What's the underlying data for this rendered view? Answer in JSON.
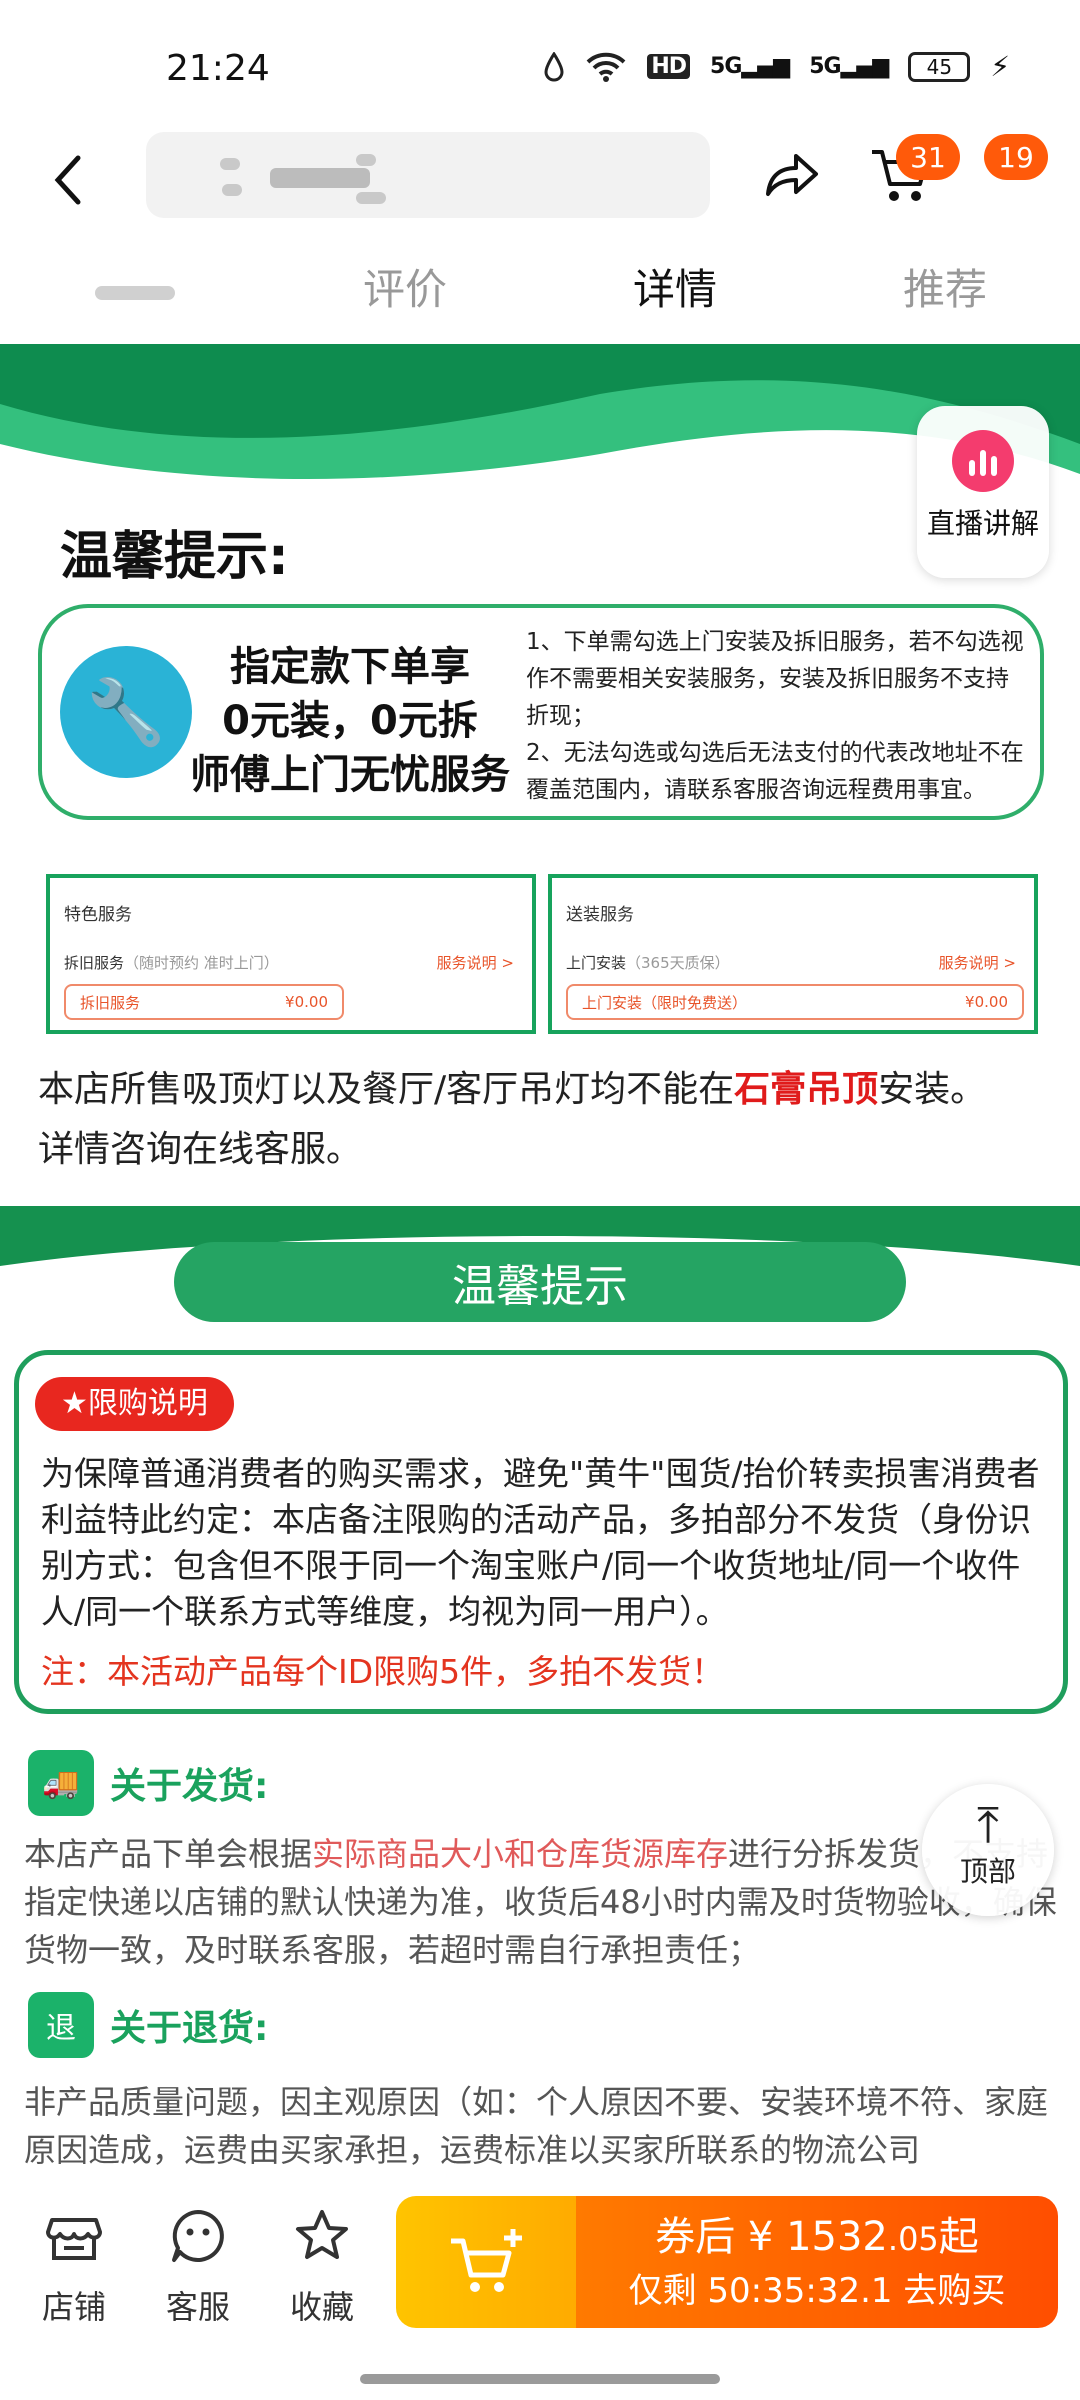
{
  "status_bar": {
    "time": "21:24",
    "network_hd": "HD",
    "signal1": "5G",
    "signal2": "5G",
    "battery": "45",
    "icons": [
      "dnd-drop-icon",
      "wifi-icon",
      "hd-icon",
      "signal-5g-icon",
      "signal-5g-icon",
      "battery-icon",
      "charging-icon"
    ]
  },
  "header": {
    "back_icon": "chevron-left-icon",
    "share_icon": "share-icon",
    "cart_icon": "cart-icon",
    "cart_badge": "31",
    "more_badge": "19"
  },
  "tabs": [
    {
      "label": "",
      "active": false
    },
    {
      "label": "评价",
      "active": false
    },
    {
      "label": "详情",
      "active": true
    },
    {
      "label": "推荐",
      "active": false
    }
  ],
  "content": {
    "live_button_label": "直播讲解",
    "warm_tip_title": "温馨提示:",
    "service_card": {
      "headline_line1": "指定款下单享",
      "headline_line2": "0元装，0元拆",
      "headline_line3": "师傅上门无忧服务",
      "note1": "1、下单需勾选上门安装及拆旧服务，若不勾选视作不需要相关安装服务，安装及拆旧服务不支持折现；",
      "note2": "2、无法勾选或勾选后无法支付的代表改地址不在覆盖范围内，请联系客服咨询远程费用事宜。"
    },
    "option_left": {
      "title": "特色服务",
      "line": "拆旧服务",
      "line_muted": "（随时预约 准时上门）",
      "link": "服务说明 >",
      "pill_label": "拆旧服务",
      "pill_price": "¥0.00"
    },
    "option_right": {
      "title": "送装服务",
      "line": "上门安装",
      "line_muted": "（365天质保）",
      "link": "服务说明 >",
      "pill_label": "上门安装（限时免费送）",
      "pill_price": "¥0.00"
    },
    "notice_pre": "本店所售吸顶灯以及餐厅/客厅吊灯均不能在",
    "notice_red": "石膏吊顶",
    "notice_post": "安装。",
    "notice_line2": "详情咨询在线客服。",
    "pill_title": "温馨提示",
    "limit_tag": "★限购说明",
    "limit_text": "为保障普通消费者的购买需求，避免\"黄牛\"囤货/抬价转卖损害消费者利益特此约定：本店备注限购的活动产品，多拍部分不发货（身份识别方式：包含但不限于同一个淘宝账户/同一个收货地址/同一个收件人/同一个联系方式等维度，均视为同一用户）。",
    "limit_note": "注：本活动产品每个ID限购5件，多拍不发货！",
    "shipping_title": "关于发货:",
    "shipping_pre": "本店产品下单会根据",
    "shipping_hl": "实际商品大小和仓库货源库存",
    "shipping_post": "进行分拆发货，不支持指定快递以店铺的默认快递为准，收货后48小时内需及时货物验收，确保货物一致，及时联系客服，若超时需自行承担责任；",
    "return_title": "关于退货:",
    "return_icon_text": "退",
    "return_text": "非产品质量问题，因主观原因（如：个人原因不要、安装环境不符、家庭原因造成，运费由买家承担，运费标准以买家所联系的物流公司",
    "top_label": "顶部"
  },
  "bottom_bar": {
    "shop_label": "店铺",
    "service_label": "客服",
    "fav_label": "收藏",
    "buy_price_prefix": "券后 ¥ 1532",
    "buy_price_decimal": ".05",
    "buy_price_suffix": "起",
    "buy_timer": "仅剩 50:35:32.1 去购买"
  },
  "colors": {
    "brand_green": "#1f9e5c",
    "buy_orange": "#ff5a00",
    "badge_orange": "#ff5a0a",
    "alert_red": "#e8271f"
  }
}
